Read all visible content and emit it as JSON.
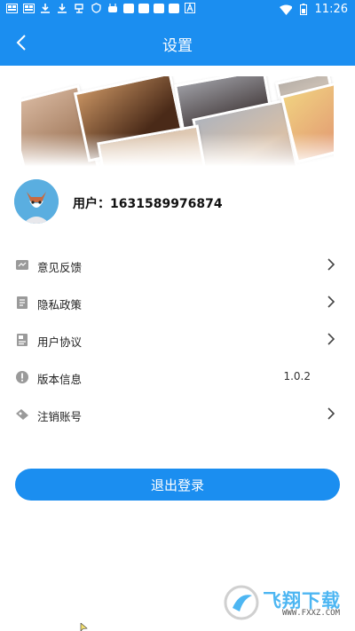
{
  "status_bar": {
    "time": "11:26",
    "icons": [
      "notification-icon",
      "notification-icon",
      "download-icon",
      "download-icon",
      "app-icon",
      "shield-icon",
      "app-icon",
      "app-icon",
      "app-icon",
      "app-icon",
      "text-a-icon",
      "wifi-icon",
      "battery-icon"
    ]
  },
  "header": {
    "back_icon": "chevron-left-icon",
    "title": "设置"
  },
  "user": {
    "label": "用户：1631589976874"
  },
  "menu": [
    {
      "label": "意见反馈",
      "icon": "feedback-icon",
      "chevron": true
    },
    {
      "label": "隐私政策",
      "icon": "document-icon",
      "chevron": true
    },
    {
      "label": "用户协议",
      "icon": "agreement-icon",
      "chevron": true
    },
    {
      "label": "版本信息",
      "icon": "info-icon",
      "value": "1.0.2"
    },
    {
      "label": "注销账号",
      "icon": "user-remove-icon",
      "chevron": true
    }
  ],
  "logout_label": "退出登录",
  "watermark": {
    "text": "飞翔下载",
    "url": "WWW.FXXZ.COM"
  },
  "colors": {
    "primary": "#1b8ef0",
    "icon_gray": "#9a9a9a"
  }
}
